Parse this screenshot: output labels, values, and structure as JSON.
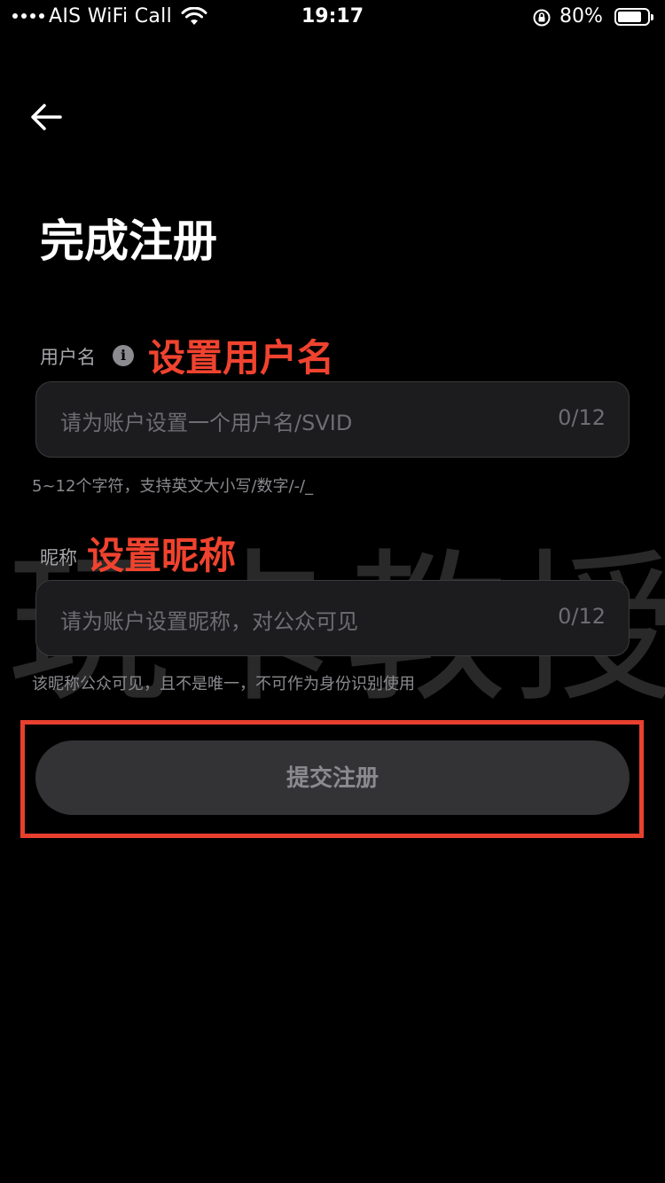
{
  "status_bar": {
    "carrier": "AIS WiFi Call",
    "time": "19:17",
    "battery": "80%",
    "battery_level": 0.8
  },
  "page": {
    "title": "完成注册"
  },
  "username": {
    "label": "用户名",
    "annotation": "设置用户名",
    "placeholder": "请为账户设置一个用户名/SVID",
    "counter": "0/12",
    "hint": "5~12个字符，支持英文大小写/数字/-/_"
  },
  "nickname": {
    "label": "昵称",
    "annotation": "设置昵称",
    "placeholder": "请为账户设置昵称，对公众可见",
    "counter": "0/12",
    "hint": "该昵称公众可见，且不是唯一，不可作为身份识别使用"
  },
  "submit": {
    "label": "提交注册"
  },
  "watermark": "玩卡教授",
  "colors": {
    "background": "#000000",
    "annotation": "#f0432f",
    "input_bg": "#1c1c1e",
    "button_bg": "#333336"
  },
  "icons": {
    "back": "arrow-left-icon",
    "info": "info-icon",
    "wifi": "wifi-icon",
    "rotation_lock": "rotation-lock-icon",
    "battery": "battery-icon"
  }
}
